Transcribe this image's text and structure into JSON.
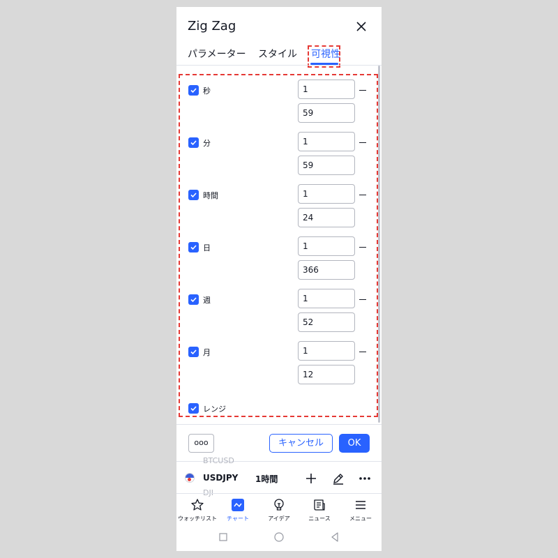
{
  "dialog": {
    "title": "Zig Zag",
    "tabs": [
      {
        "label": "パラメーター"
      },
      {
        "label": "スタイル"
      },
      {
        "label": "可視性"
      }
    ]
  },
  "visibility": {
    "rows": [
      {
        "label": "秒",
        "checked": true,
        "from": "1",
        "to": "59"
      },
      {
        "label": "分",
        "checked": true,
        "from": "1",
        "to": "59"
      },
      {
        "label": "時間",
        "checked": true,
        "from": "1",
        "to": "24"
      },
      {
        "label": "日",
        "checked": true,
        "from": "1",
        "to": "366"
      },
      {
        "label": "週",
        "checked": true,
        "from": "1",
        "to": "52"
      },
      {
        "label": "月",
        "checked": true,
        "from": "1",
        "to": "12"
      }
    ],
    "ranges": {
      "label": "レンジ",
      "checked": true
    }
  },
  "footer": {
    "more_label": "ooo",
    "cancel_label": "キャンセル",
    "ok_label": "OK"
  },
  "toolbar": {
    "ghost_symbol_above": "BTCUSD",
    "ghost_symbol_below": "DJI",
    "symbol": "USDJPY",
    "interval": "1時間"
  },
  "bottom_nav": [
    {
      "label": "ウォッチリスト",
      "icon": "star-icon"
    },
    {
      "label": "チャート",
      "icon": "chart-icon",
      "active": true
    },
    {
      "label": "アイデア",
      "icon": "lightbulb-icon"
    },
    {
      "label": "ニュース",
      "icon": "news-icon"
    },
    {
      "label": "メニュー",
      "icon": "menu-icon"
    }
  ],
  "colors": {
    "accent": "#2962ff",
    "highlight": "#e53935",
    "text": "#131722",
    "backdrop": "#d9d9d9"
  }
}
